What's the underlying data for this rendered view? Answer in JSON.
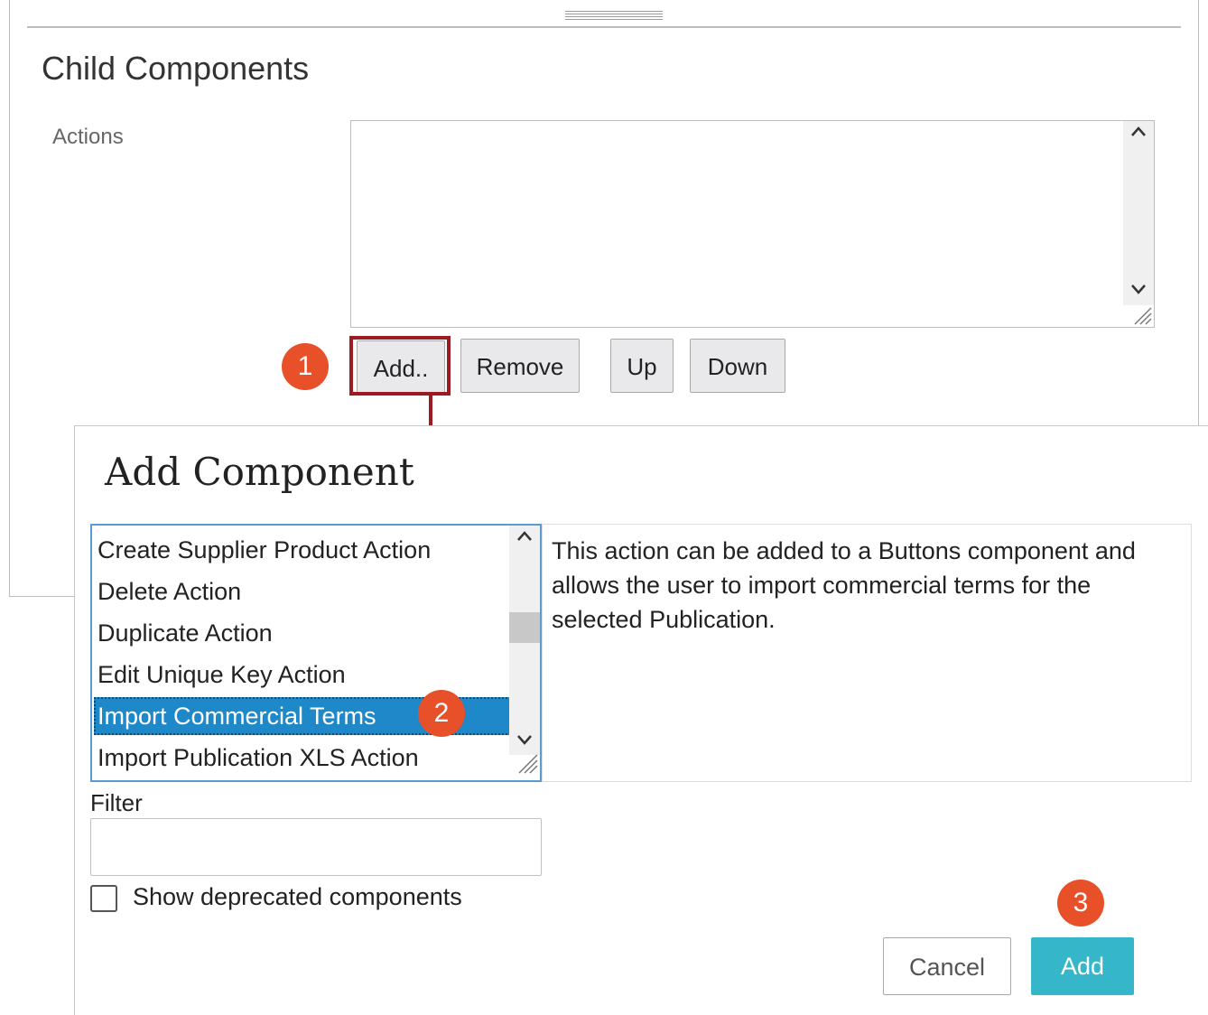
{
  "parent_panel": {
    "section_title": "Child Components",
    "actions_label": "Actions",
    "buttons": {
      "add": "Add..",
      "remove": "Remove",
      "up": "Up",
      "down": "Down"
    }
  },
  "callouts": {
    "step1": "1",
    "step2": "2",
    "step3": "3"
  },
  "dialog": {
    "title": "Add Component",
    "components": [
      "Create Supplier Product Action",
      "Delete Action",
      "Duplicate Action",
      "Edit Unique Key Action",
      "Import Commercial Terms",
      "Import Publication XLS Action"
    ],
    "selected_index": 4,
    "description": "This action can be added to a Buttons component and allows the user to import commercial terms for the selected Publication.",
    "filter_label": "Filter",
    "filter_value": "",
    "show_deprecated_label": "Show deprecated components",
    "show_deprecated_checked": false,
    "cancel_label": "Cancel",
    "add_label": "Add"
  },
  "colors": {
    "highlight": "#9b1b23",
    "callout": "#e8502a",
    "selection": "#1e88c8",
    "primary_button": "#35b7c9"
  }
}
